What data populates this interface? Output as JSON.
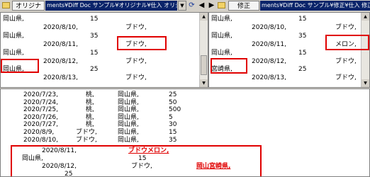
{
  "left": {
    "tag": "オリジナル",
    "path": "ments¥Diff Doc サンプル¥オリジナル¥仕入 オリジナル.CSV",
    "rows": [
      {
        "a": "岡山県,",
        "b": "15",
        "c": ""
      },
      {
        "a": "2020/8/10,",
        "b": "",
        "c": "ブドウ,"
      },
      {
        "a": "岡山県,",
        "b": "35",
        "c": ""
      },
      {
        "a": "2020/8/11,",
        "b": "",
        "c": "ブドウ,"
      },
      {
        "a": "岡山県,",
        "b": "15",
        "c": ""
      },
      {
        "a": "2020/8/12,",
        "b": "",
        "c": "ブドウ,"
      },
      {
        "a": "岡山県,",
        "b": "25",
        "c": ""
      },
      {
        "a": "2020/8/13,",
        "b": "",
        "c": "ブドウ,"
      }
    ]
  },
  "right": {
    "tag": "修正",
    "path": "ments¥Diff Doc サンプル¥修正¥仕入 修正.c",
    "rows": [
      {
        "a": "岡山県,",
        "b": "15",
        "c": ""
      },
      {
        "a": "2020/8/10,",
        "b": "",
        "c": "ブドウ,"
      },
      {
        "a": "岡山県,",
        "b": "35",
        "c": ""
      },
      {
        "a": "2020/8/11,",
        "b": "",
        "c": "メロン,"
      },
      {
        "a": "岡山県,",
        "b": "15",
        "c": ""
      },
      {
        "a": "2020/8/12,",
        "b": "",
        "c": "ブドウ,"
      },
      {
        "a": "宮崎県,",
        "b": "25",
        "c": ""
      },
      {
        "a": "2020/8/13,",
        "b": "",
        "c": "ブドウ,"
      }
    ]
  },
  "bottom": {
    "rows": [
      {
        "d": "2020/7/23,",
        "f": "桃,",
        "p": "岡山県,",
        "n": "25"
      },
      {
        "d": "2020/7/24,",
        "f": "桃,",
        "p": "岡山県,",
        "n": "50"
      },
      {
        "d": "2020/7/25,",
        "f": "桃,",
        "p": "岡山県,",
        "n": "500"
      },
      {
        "d": "2020/7/26,",
        "f": "桃,",
        "p": "岡山県,",
        "n": "5"
      },
      {
        "d": "2020/7/27,",
        "f": "桃,",
        "p": "岡山県,",
        "n": "30"
      },
      {
        "d": "2020/8/9,",
        "f": "ブドウ,",
        "p": "岡山県,",
        "n": "15"
      },
      {
        "d": "2020/8/10,",
        "f": "ブドウ,",
        "p": "岡山県,",
        "n": "35"
      }
    ],
    "diff": {
      "r1_date": "2020/8/11,",
      "r1_fruit": "ブドウメロン,",
      "r2_pref": "岡山県,",
      "r2_num": "15",
      "r3_date": "2020/8/12,",
      "r3_fruit": "ブドウ,",
      "r3_pref": "岡山宮崎県,",
      "r4_num": "25"
    }
  },
  "colors": {
    "diff_red": "#e00000",
    "path_bg": "#0a246a"
  }
}
